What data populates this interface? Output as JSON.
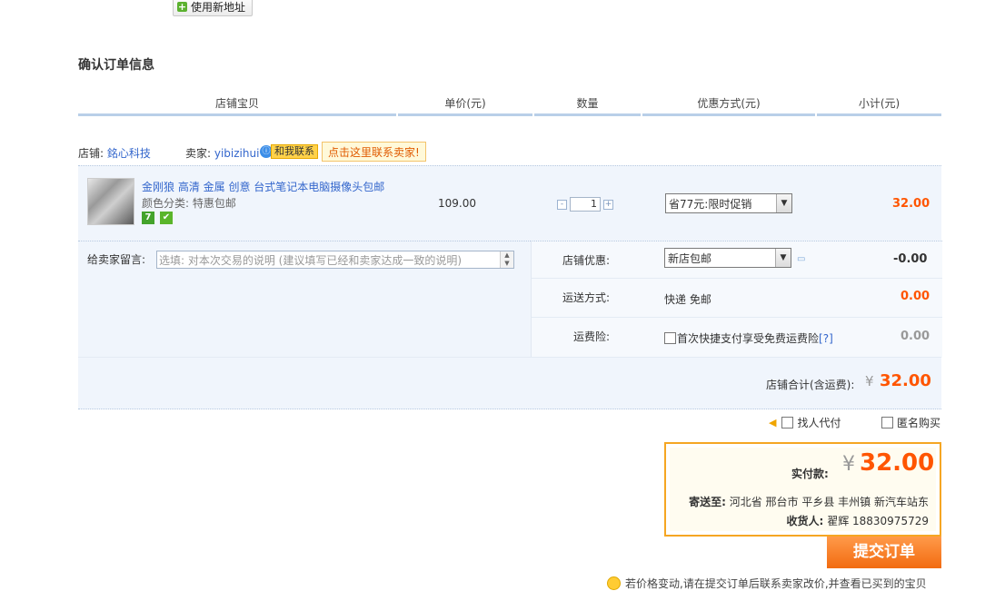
{
  "add_address_button": "使用新地址",
  "section_title": "确认订单信息",
  "columns": [
    "店铺宝贝",
    "单价(元)",
    "数量",
    "优惠方式(元)",
    "小计(元)"
  ],
  "store": {
    "label": "店铺:",
    "name": "銘心科技",
    "seller_label": "卖家:",
    "seller_name": "yibizihui",
    "chat_label": "和我联系",
    "contact_tip": "点击这里联系卖家!"
  },
  "item": {
    "name": "金刚狼 高清 金属 创意 台式笔记本电脑摄像头包邮",
    "sku": "颜色分类: 特惠包邮",
    "badges": [
      "7",
      "✔"
    ],
    "price": "109.00",
    "qty_minus": "-",
    "quantity": "1",
    "qty_plus": "+",
    "discount_option": "省77元:限时促销",
    "subtotal": "32.00"
  },
  "message": {
    "label": "给卖家留言:",
    "placeholder": "选填: 对本次交易的说明 (建议填写已经和卖家达成一致的说明)"
  },
  "store_discount": {
    "label": "店铺优惠:",
    "option": "新店包邮",
    "value": "-0.00"
  },
  "shipping": {
    "label": "运送方式:",
    "method": "快递 免邮",
    "value": "0.00"
  },
  "insurance": {
    "label": "运费险:",
    "option_text": "首次快捷支付享受免费运费险",
    "help": "[?]",
    "value": "0.00"
  },
  "store_total": {
    "label": "店铺合计(含运费):",
    "currency": "¥",
    "value": "32.00"
  },
  "options": {
    "proxy_pay": "找人代付",
    "anonymous": "匿名购买"
  },
  "payment": {
    "label": "实付款:",
    "currency": "¥",
    "amount": "32.00",
    "ship_to_label": "寄送至:",
    "address": "河北省 邢台市 平乡县 丰州镇 新汽车站东",
    "receiver_label": "收货人:",
    "receiver": "翟辉 18830975729"
  },
  "submit_button": "提交订单",
  "bottom_tip": "若价格变动,请在提交订单后联系卖家改价,并查看已买到的宝贝"
}
